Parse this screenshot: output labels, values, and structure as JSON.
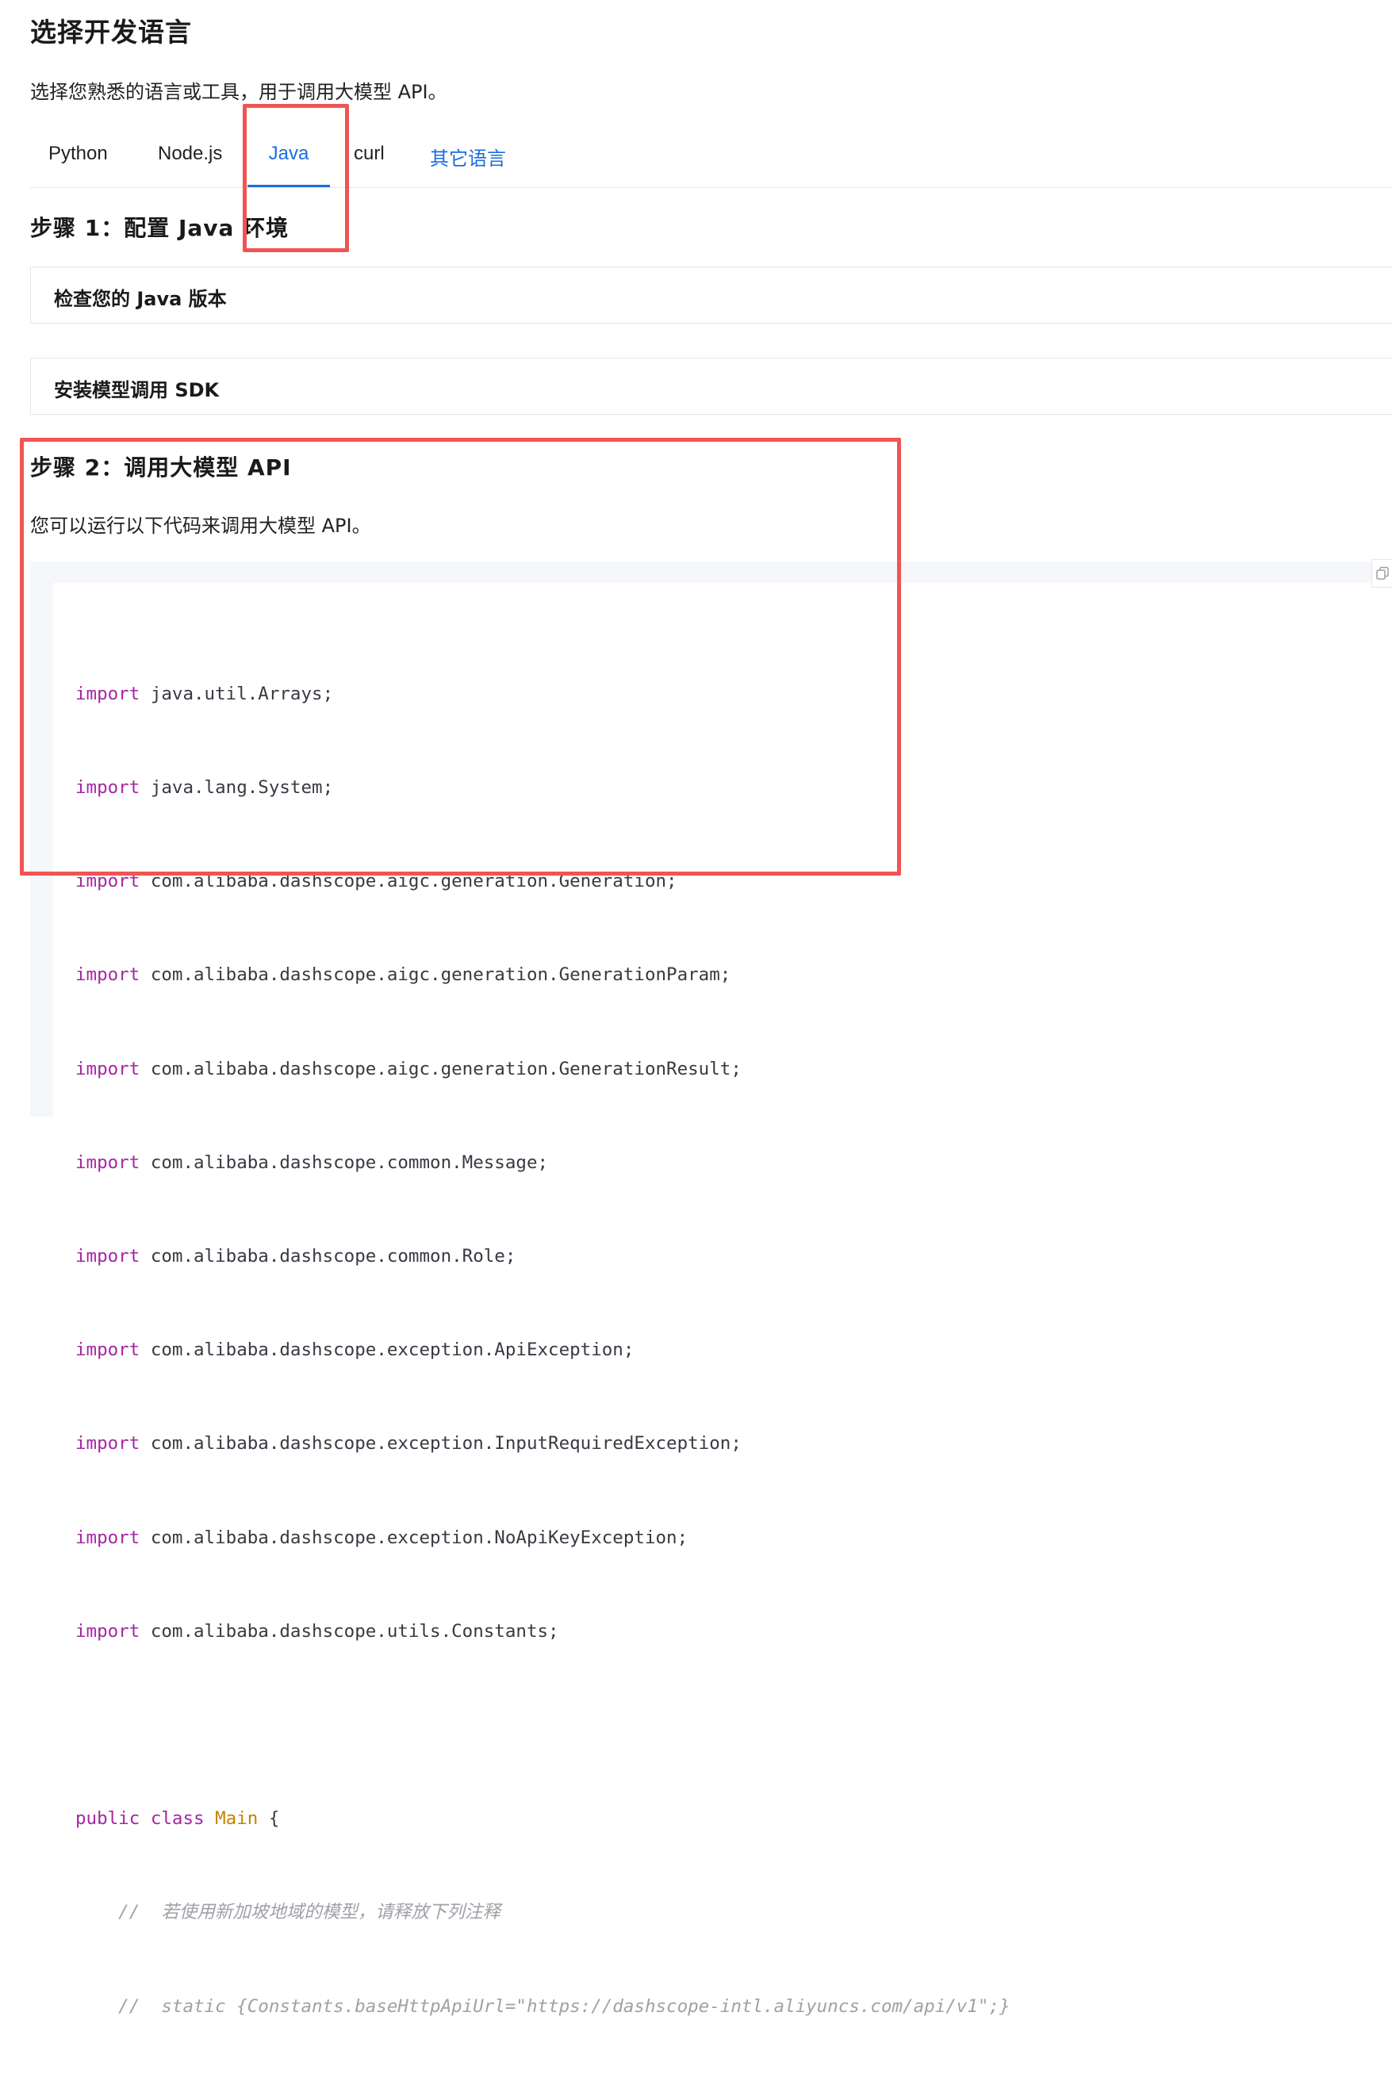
{
  "page": {
    "title": "选择开发语言",
    "description": "选择您熟悉的语言或工具，用于调用大模型 API。"
  },
  "tabs": [
    {
      "label": "Python",
      "active": false
    },
    {
      "label": "Node.js",
      "active": false
    },
    {
      "label": "Java",
      "active": true
    },
    {
      "label": "curl",
      "active": false
    },
    {
      "label": "其它语言",
      "active": false,
      "link": true
    }
  ],
  "step1": {
    "heading": "步骤 1：配置 Java 环境",
    "accordions": [
      "检查您的 Java 版本",
      "安装模型调用 SDK"
    ]
  },
  "step2": {
    "heading": "步骤 2：调用大模型 API",
    "description": "您可以运行以下代码来调用大模型 API。"
  },
  "code": {
    "imports": [
      "java.util.Arrays;",
      "java.lang.System;",
      "com.alibaba.dashscope.aigc.generation.Generation;",
      "com.alibaba.dashscope.aigc.generation.GenerationParam;",
      "com.alibaba.dashscope.aigc.generation.GenerationResult;",
      "com.alibaba.dashscope.common.Message;",
      "com.alibaba.dashscope.common.Role;",
      "com.alibaba.dashscope.exception.ApiException;",
      "com.alibaba.dashscope.exception.InputRequiredException;",
      "com.alibaba.dashscope.exception.NoApiKeyException;",
      "com.alibaba.dashscope.utils.Constants;"
    ],
    "import_keyword": "import",
    "class_decl": {
      "kw1": "public",
      "kw2": "class",
      "name": "Main",
      "brace": "{"
    },
    "comment1": "    //  若使用新加坡地域的模型，请释放下列注释",
    "comment2": "    //  static {Constants.baseHttpApiUrl=\"https://dashscope-intl.aliyuncs.com/api/v1\";}"
  },
  "icons": {
    "copy": "copy-icon"
  },
  "colors": {
    "accent": "#1a6de0",
    "highlight_box": "#f05454",
    "code_keyword": "#a626a4",
    "code_class": "#c18401",
    "code_comment": "#a0a1a7"
  }
}
